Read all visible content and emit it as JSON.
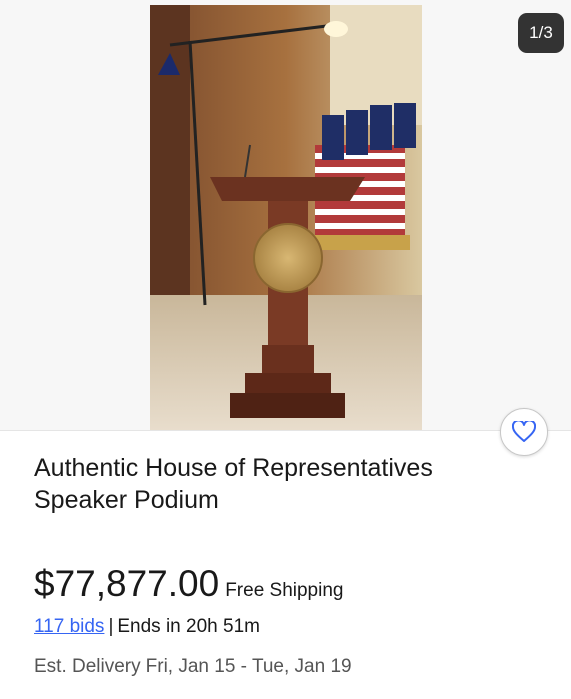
{
  "gallery": {
    "counter": "1/3",
    "image_alt": "Authentic House of Representatives Speaker Podium"
  },
  "listing": {
    "title_line1": "Authentic House of Representatives",
    "title_line2": "Speaker Podium",
    "price": "$77,877.00",
    "shipping": "Free Shipping",
    "bids": "117 bids",
    "separator": "|",
    "ends": "Ends in 20h 51m",
    "delivery_label": "Est. Delivery",
    "delivery_range": "Fri, Jan 15 - Tue, Jan 19"
  },
  "icons": {
    "watch": "heart-icon"
  },
  "colors": {
    "link": "#3665f3",
    "text": "#191919",
    "muted": "#555555",
    "counter_bg": "#333333"
  }
}
